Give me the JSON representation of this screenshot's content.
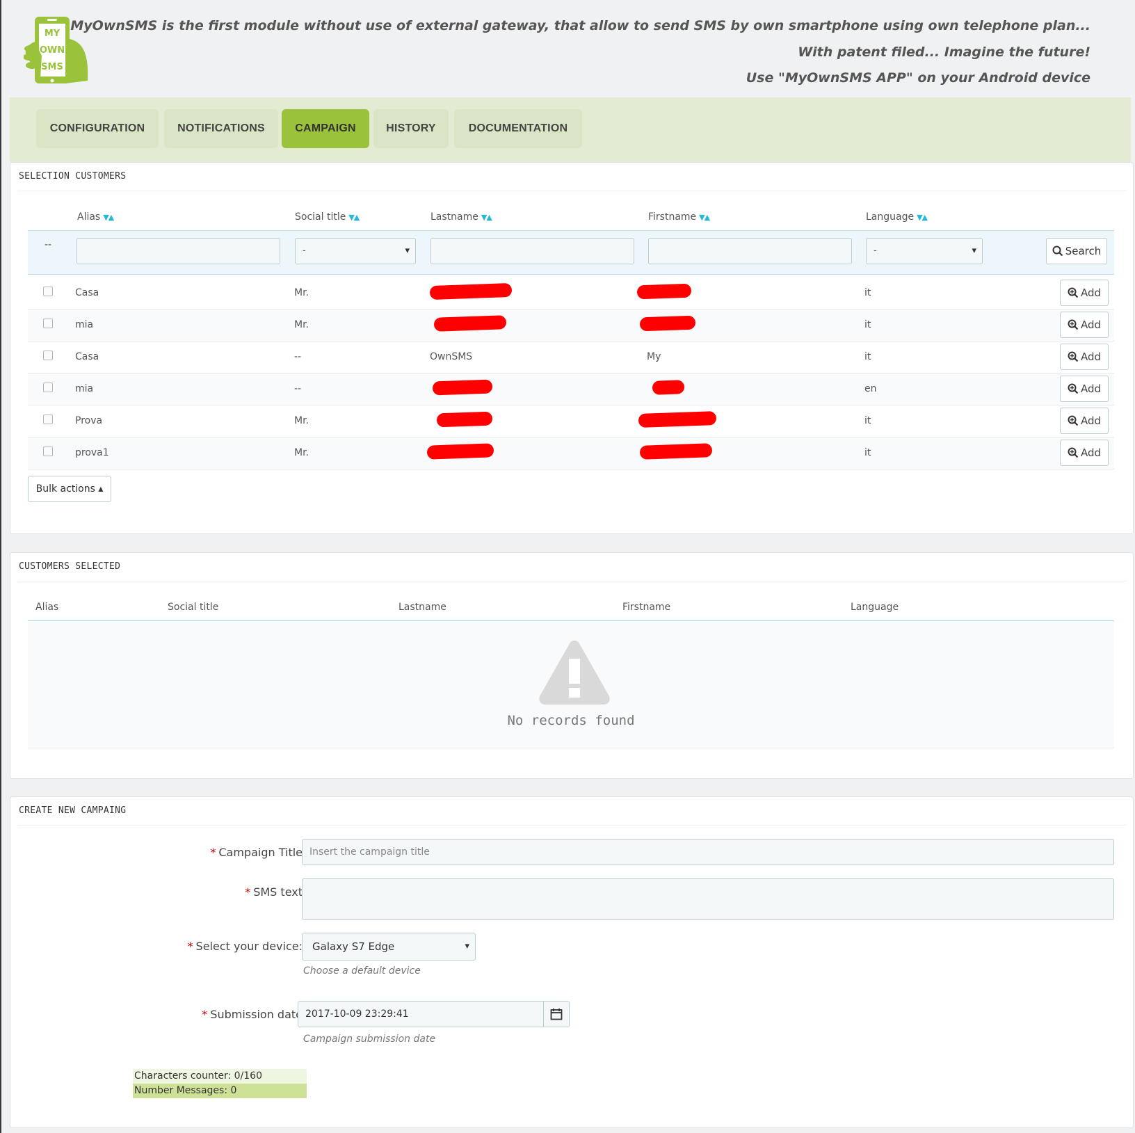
{
  "header": {
    "logo_text": [
      "MY",
      "OWN",
      "SMS"
    ],
    "tagline_1": "MyOwnSMS is the first module without use of external gateway, that allow to send SMS by own smartphone using own telephone plan...",
    "tagline_2": "With patent filed... Imagine the future!",
    "tagline_3": "Use \"MyOwnSMS APP\" on your Android device"
  },
  "tabs": [
    {
      "label": "CONFIGURATION",
      "active": false
    },
    {
      "label": "NOTIFICATIONS",
      "active": false
    },
    {
      "label": "CAMPAIGN",
      "active": true
    },
    {
      "label": "HISTORY",
      "active": false
    },
    {
      "label": "DOCUMENTATION",
      "active": false
    }
  ],
  "selection": {
    "title": "SELECTION CUSTOMERS",
    "columns": [
      "Alias",
      "Social title",
      "Lastname",
      "Firstname",
      "Language"
    ],
    "filter": {
      "dash": "--",
      "social_title_value": "-",
      "language_value": "-",
      "search_label": "Search"
    },
    "rows": [
      {
        "alias": "Casa",
        "social_title": "Mr.",
        "lastname": "",
        "firstname": "",
        "language": "it",
        "lastname_redacted": true,
        "firstname_redacted": true
      },
      {
        "alias": "mia",
        "social_title": "Mr.",
        "lastname": "",
        "firstname": "",
        "language": "it",
        "lastname_redacted": true,
        "firstname_redacted": true
      },
      {
        "alias": "Casa",
        "social_title": "--",
        "lastname": "OwnSMS",
        "firstname": "My",
        "language": "it",
        "lastname_redacted": false,
        "firstname_redacted": false
      },
      {
        "alias": "mia",
        "social_title": "--",
        "lastname": "",
        "firstname": "",
        "language": "en",
        "lastname_redacted": true,
        "firstname_redacted": true
      },
      {
        "alias": "Prova",
        "social_title": "Mr.",
        "lastname": "",
        "firstname": "",
        "language": "it",
        "lastname_redacted": true,
        "firstname_redacted": true
      },
      {
        "alias": "prova1",
        "social_title": "Mr.",
        "lastname": "",
        "firstname": "",
        "language": "it",
        "lastname_redacted": true,
        "firstname_redacted": true
      }
    ],
    "add_label": "Add",
    "bulk_label": "Bulk actions ▴"
  },
  "selected": {
    "title": "CUSTOMERS SELECTED",
    "columns": [
      "Alias",
      "Social title",
      "Lastname",
      "Firstname",
      "Language"
    ],
    "empty_text": "No records found"
  },
  "campaign": {
    "title": "CREATE NEW CAMPAING",
    "campaign_title_label": "Campaign Title",
    "campaign_title_placeholder": "Insert the campaign title",
    "sms_text_label": "SMS text",
    "sms_text_value": "",
    "device_label": "Select your device:",
    "device_value": "Galaxy S7 Edge",
    "device_hint": "Choose a default device",
    "date_label": "Submission date",
    "date_value": "2017-10-09 23:29:41",
    "date_hint": "Campaign submission date",
    "chars_counter": "Characters counter: 0/160",
    "messages_counter": "Number Messages: 0",
    "required_mark": "*"
  },
  "colors": {
    "accent": "#9ac33b",
    "tab_bg": "#d9e5c4",
    "tabbar_bg": "#e3ebd3",
    "sort_arrow": "#25b9d7",
    "redaction": "#ff0000",
    "counter_light": "#eef5e0",
    "counter_dark": "#cde296"
  }
}
